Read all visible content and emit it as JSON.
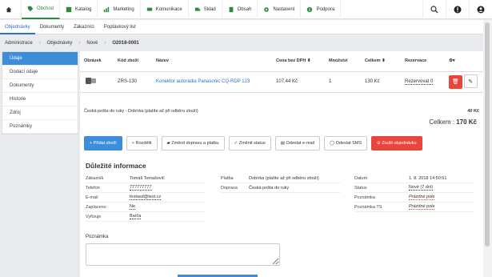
{
  "nav": {
    "items": [
      {
        "label": "Obchod",
        "icon": "tag-icon"
      },
      {
        "label": "Katalog",
        "icon": "book-icon"
      },
      {
        "label": "Marketing",
        "icon": "chart-icon"
      },
      {
        "label": "Komunikace",
        "icon": "chat-icon"
      },
      {
        "label": "Sklad",
        "icon": "truck-icon"
      },
      {
        "label": "Obsah",
        "icon": "file-icon"
      },
      {
        "label": "Nastavení",
        "icon": "gear-icon"
      },
      {
        "label": "Podpora",
        "icon": "info-icon"
      }
    ],
    "active_index": 0
  },
  "subnav": [
    "Objednávky",
    "Dokumenty",
    "Zákazníci",
    "Poptávkový list"
  ],
  "breadcrumb": {
    "a": "Administrace",
    "b": "Objednávky",
    "c": "Nové",
    "d": "O2018-0001"
  },
  "sidebar": [
    "Údaje",
    "Dodací údaje",
    "Dokumenty",
    "Historie",
    "Zdroj",
    "Poznámky"
  ],
  "table": {
    "headers": [
      "Obrázek",
      "Kód zboží",
      "Název",
      "Cena bez DPH ⬍",
      "Množství",
      "Celkem ⬍",
      "Rezervace",
      "⚙▾"
    ],
    "row": {
      "code": "ZRS-130",
      "name": "Konektor autorádia Panasonic CQ-RDP 123",
      "price": "107,44 Kč",
      "qty": "1",
      "total": "130 Kč",
      "reservation": "Rezervovat 0"
    }
  },
  "shipping": {
    "text": "Česká pošta do ruky - Dobírka (platíte až při odběru zboží)",
    "price": "40 Kč"
  },
  "total": {
    "label": "Celkem :",
    "value": "170 Kč"
  },
  "actions": [
    "+ Přidat zboží",
    "Rozdělit",
    "Změnit dopravu a platbu",
    "Změnit status",
    "Odeslat e-mail",
    "Odeslat SMS",
    "Zrušit objednávku"
  ],
  "info": {
    "title": "Důležité informace",
    "left": [
      {
        "k": "Zákazník",
        "v": "Tomáš Tomašovič"
      },
      {
        "k": "Telefon",
        "v": "777777777"
      },
      {
        "k": "E-mail",
        "v": "testasd@test.cz"
      },
      {
        "k": "Zaplaceno",
        "v": "Ne"
      },
      {
        "k": "Vyřizuje",
        "v": "Barča"
      }
    ],
    "middle": [
      {
        "k": "Platba",
        "v": "Dobírka (platíte až při odběru zboží)"
      },
      {
        "k": "Doprava",
        "v": "Česká pošta do ruky"
      }
    ],
    "right": [
      {
        "k": "Datum",
        "v": "1. 8. 2018 14:50:51"
      },
      {
        "k": "Status",
        "v": "Nové (7 dní)"
      },
      {
        "k": "Poznámka",
        "v": "Prázdné pole"
      },
      {
        "k": "Poznámka TS",
        "v": "Prázdné pole"
      }
    ]
  },
  "note_label": "Poznámka",
  "colors": {
    "accent": "#3c8edb",
    "brand": "#2f8a3b",
    "danger": "#e8453c"
  }
}
